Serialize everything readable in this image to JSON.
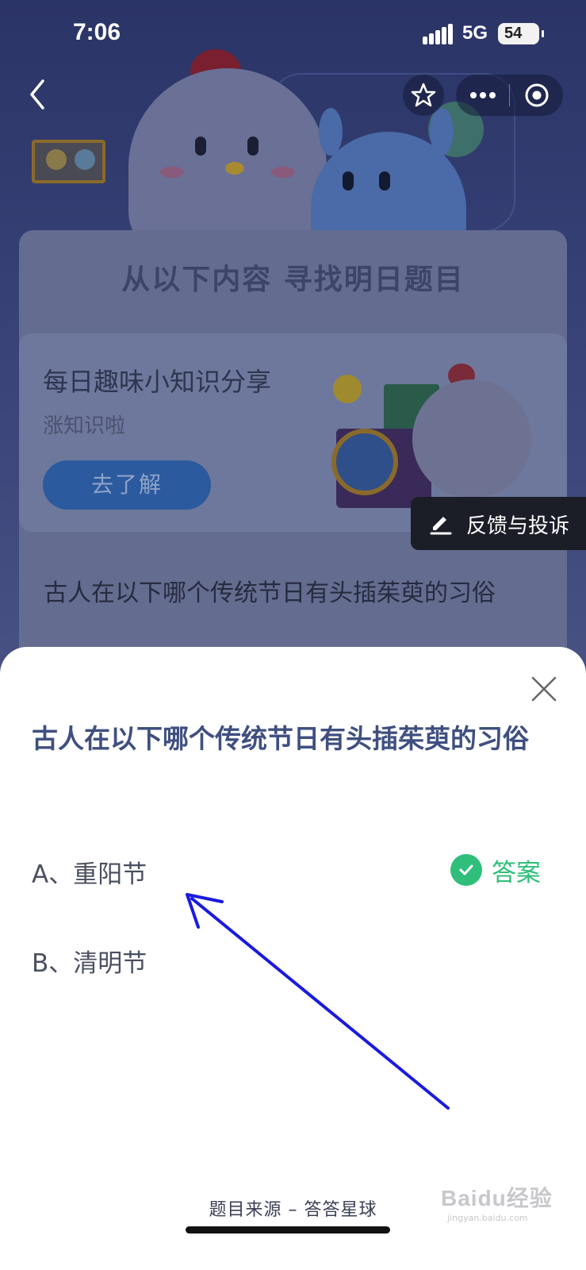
{
  "status_bar": {
    "time": "7:06",
    "network": "5G",
    "battery": "54"
  },
  "page": {
    "section_title": "从以下内容 寻找明日题目",
    "card": {
      "title": "每日趣味小知识分享",
      "subtitle": "涨知识啦",
      "button_label": "去了解"
    },
    "feedback_label": "反馈与投诉",
    "background_question": "古人在以下哪个传统节日有头插茱萸的习俗"
  },
  "sheet": {
    "question": "古人在以下哪个传统节日有头插茱萸的习俗",
    "options": [
      {
        "label": "A、重阳节",
        "is_answer": true
      },
      {
        "label": "B、清明节",
        "is_answer": false
      }
    ],
    "answer_label": "答案",
    "source": "题目来源 – 答答星球"
  },
  "watermark": {
    "brand": "Baidu经验",
    "site": "jingyan.baidu.com"
  },
  "colors": {
    "accent_green": "#2fbf7a",
    "question_blue": "#3f4f80",
    "annotation_arrow": "#1a1ae0"
  },
  "icons": [
    "back-icon",
    "star-icon",
    "more-icon",
    "target-icon",
    "edit-icon",
    "close-icon",
    "check-icon"
  ]
}
